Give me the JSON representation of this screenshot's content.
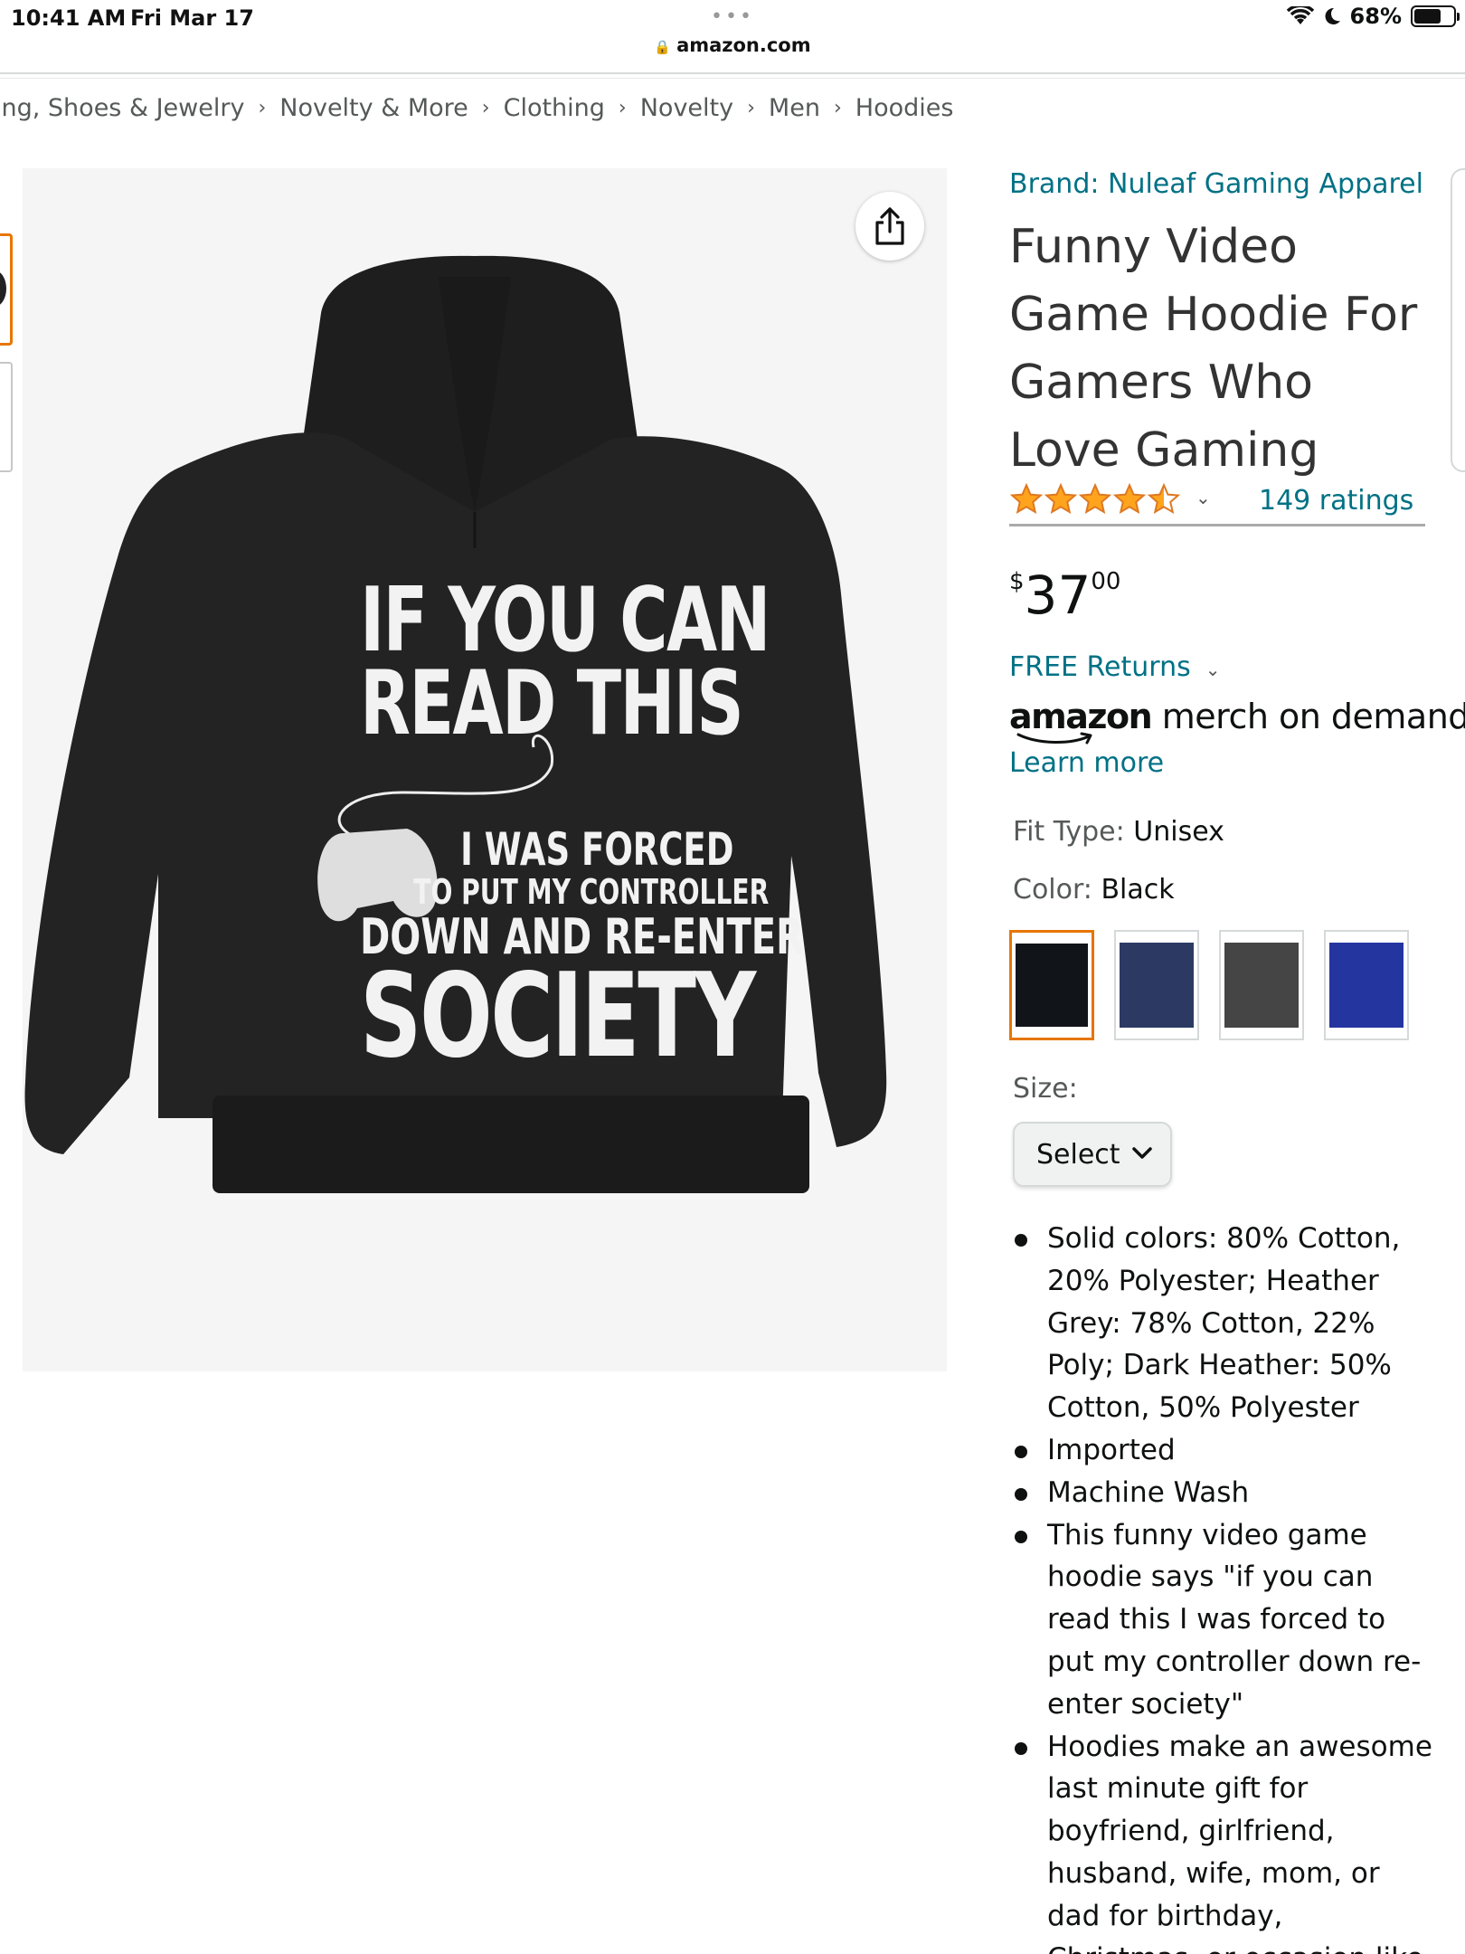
{
  "status_bar": {
    "time": "10:41 AM",
    "date": "Fri Mar 17",
    "battery": "68%",
    "battery_level": 0.68,
    "url": "amazon.com"
  },
  "breadcrumb": {
    "items": [
      "ing, Shoes & Jewelry",
      "Novelty & More",
      "Clothing",
      "Novelty",
      "Men",
      "Hoodies"
    ],
    "separator": "›"
  },
  "gallery": {
    "print_text": {
      "line1": "IF YOU CAN",
      "line2": "READ THIS",
      "line3": "I WAS FORCED",
      "line4": "TO PUT MY CONTROLLER",
      "line5": "DOWN AND RE-ENTER",
      "line6": "SOCIETY"
    },
    "share_icon": "share-icon"
  },
  "product": {
    "brand": "Brand: Nuleaf Gaming Apparel",
    "title": "Funny Video Game Hoodie For Gamers Who Love Gaming",
    "rating_stars": 4.5,
    "ratings_count": "149 ratings",
    "price": {
      "symbol": "$",
      "whole": "37",
      "fraction": "00"
    },
    "returns": "FREE Returns",
    "merch_logo": {
      "amazon": "amazon",
      "rest": "merch on demand"
    },
    "learn_more": "Learn more",
    "fit_type": {
      "label": "Fit Type:",
      "value": "Unisex"
    },
    "color": {
      "label": "Color:",
      "value": "Black"
    },
    "swatches": [
      {
        "name": "Black",
        "color": "#111418",
        "selected": true
      },
      {
        "name": "Navy",
        "color": "#2c3a63",
        "selected": false
      },
      {
        "name": "Dark Heather",
        "color": "#454545",
        "selected": false
      },
      {
        "name": "Royal Blue",
        "color": "#2435a0",
        "selected": false
      }
    ],
    "size": {
      "label": "Size:",
      "select": "Select"
    },
    "bullets": [
      "Solid colors: 80% Cotton, 20% Polyester; Heather Grey: 78% Cotton, 22% Poly; Dark Heather: 50% Cotton, 50% Polyester",
      "Imported",
      "Machine Wash",
      "This funny video game hoodie says \"if you can read this I was forced to put my controller down re-enter society\"",
      "Hoodies make an awesome last minute gift for boyfriend, girlfriend, husband, wife, mom, or dad for birthday, Christmas, or occasion like Father's Day"
    ]
  },
  "colors": {
    "link": "#007185",
    "accent_orange": "#e77600",
    "star": "#ffa41c"
  }
}
